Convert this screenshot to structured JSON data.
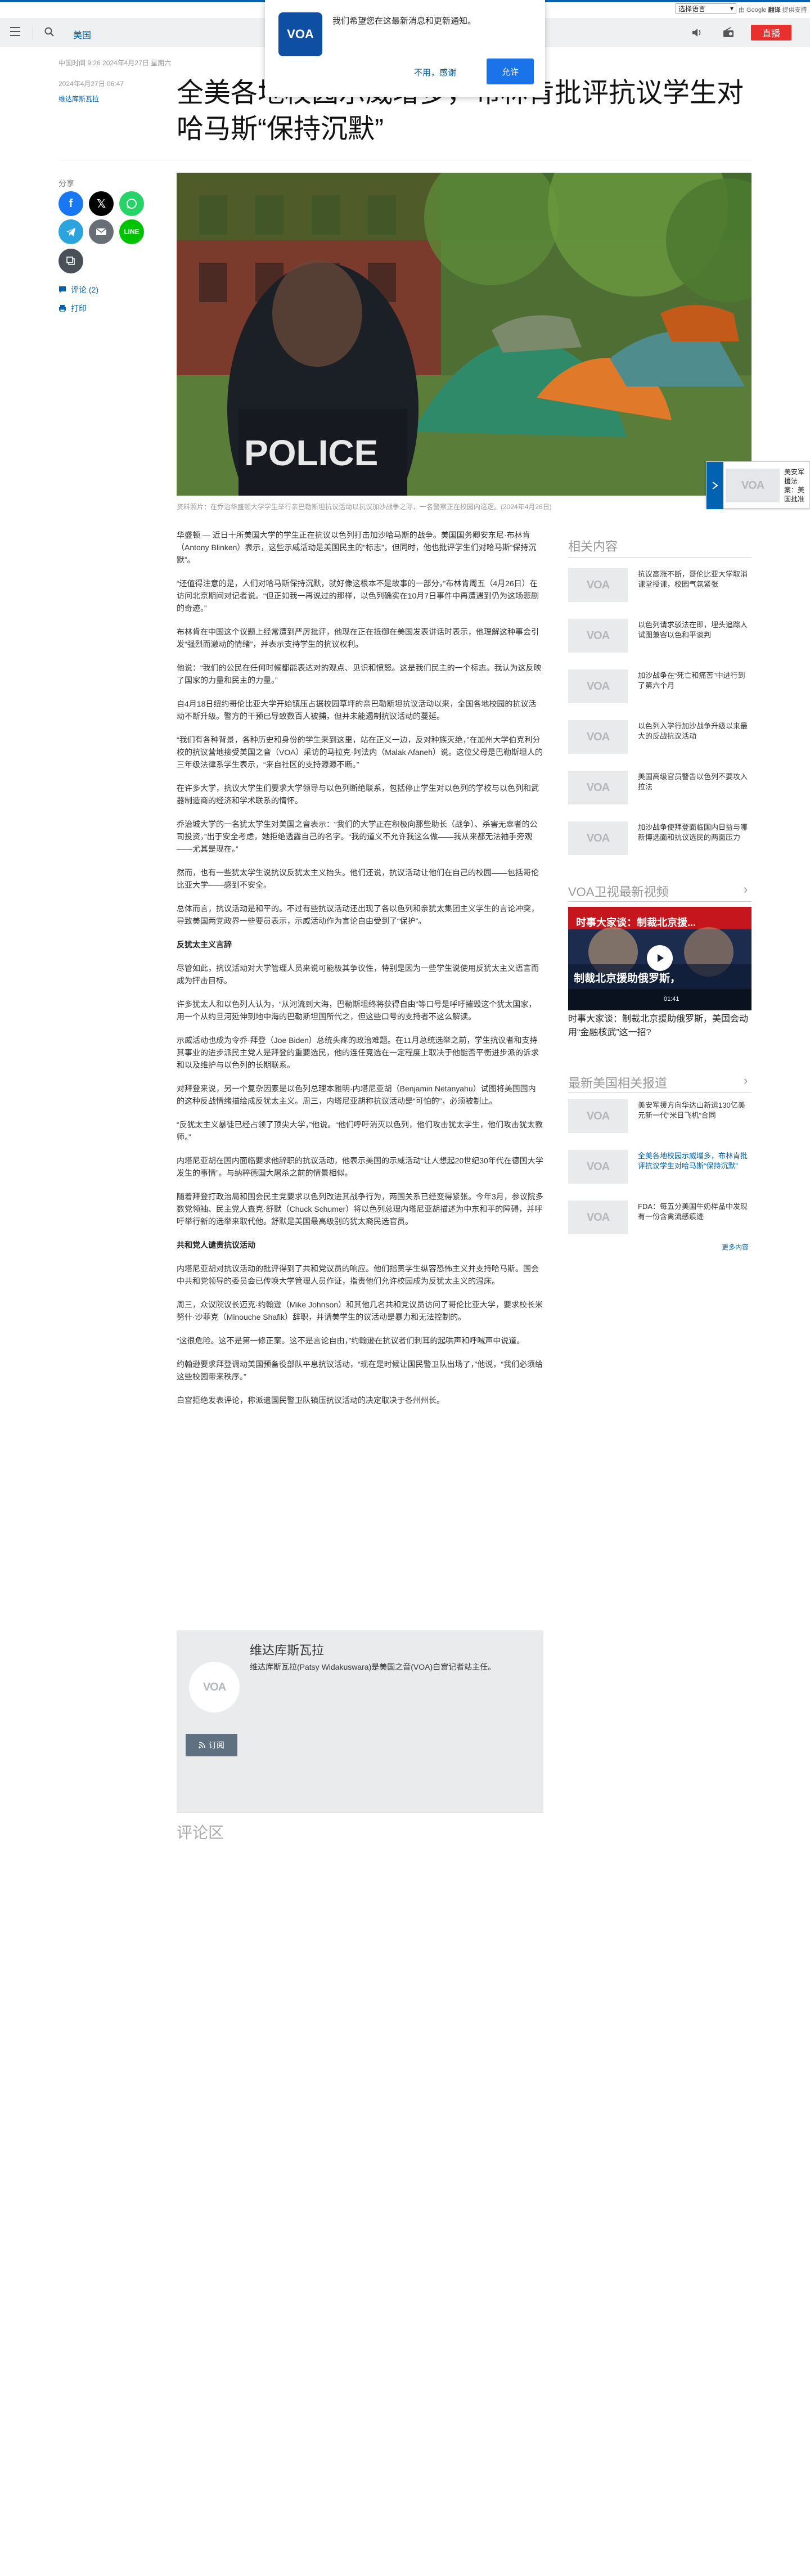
{
  "top": {
    "lang_select": "选择语言",
    "translate_prefix": "由 Google",
    "translate_brand": "翻译",
    "translate_suffix": "提供支持"
  },
  "nav": {
    "section": "美国",
    "live": "直播"
  },
  "popup": {
    "logo": "VOA",
    "message": "我们希望您在这最新消息和更新通知。",
    "decline": "不用，感谢",
    "accept": "允许"
  },
  "article": {
    "meta1": "中国时间 9:26 2024年4月27日 星期六",
    "meta2": "2024年4月27日 06:47",
    "author": "维达库斯瓦拉",
    "headline": "全美各地校园示威增多，布林肯批评抗议学生对哈马斯“保持沉默”",
    "share_label": "分享",
    "comments_link": "评论 (2)",
    "print_link": "打印",
    "caption": "资料照片：在乔治华盛顿大学学生举行亲巴勒斯坦抗议活动以抗议加沙战争之际，一名警察正在校园内巡逻。(2024年4月26日)",
    "police_text": "POLICE",
    "paragraphs": [
      "华盛顿 — 近日十所美国大学的学生正在抗议以色列打击加沙哈马斯的战争。美国国务卿安东尼·布林肯（Antony Blinken）表示，这些示威活动是美国民主的“标志”，但同时，他也批评学生们对哈马斯“保持沉默”。",
      "“还值得注意的是，人们对哈马斯保持沉默，就好像这根本不是故事的一部分，”布林肯周五（4月26日）在访问北京期间对记者说。“但正如我一再说过的那样，以色列确实在10月7日事件中再遭遇到仍为这场悲剧的奇迹。”",
      "布林肯在中国这个议题上经常遭到严厉批评，他现在正在抵御在美国发表讲话时表示，他理解这种事会引发“强烈而激动的情绪”，并表示支持学生的抗议权利。",
      "他说：“我们的公民在任何时候都能表达对的观点、见识和愤怒。这是我们民主的一个标志。我认为这反映了国家的力量和民主的力量。”",
      "自4月18日纽约哥伦比亚大学开始镇压占据校园草坪的亲巴勒斯坦抗议活动以来，全国各地校园的抗议活动不断升级。警方的干预已导致数百人被捕，但并未能遏制抗议活动的蔓延。",
      "“我们有各种背景，各种历史和身份的学生来到这里，站在正义一边，反对种族灭绝，”在加州大学伯克利分校的抗议营地接受美国之音（VOA）采访的马拉克·阿法内（Malak Afaneh）说。这位父母是巴勒斯坦人的三年级法律系学生表示，“来自社区的支持源源不断。”",
      "在许多大学，抗议大学生们要求大学领导与以色列断绝联系，包括停止学生对以色列的学校与以色列和武器制造商的经济和学术联系的情怀。",
      "乔治城大学的一名犹太学生对美国之音表示：“我们的大学正在积极向那些助长（战争）、杀害无辜者的公司投资，”出于安全考虑，她拒绝透露自己的名字。“我的道义不允许我这么做——我从来都无法袖手旁观——尤其是现在。”",
      "然而，也有一些犹太学生说抗议反犹太主义抬头。他们还说，抗议活动让他们在自己的校园——包括哥伦比亚大学——感到不安全。",
      "总体而言，抗议活动是和平的。不过有些抗议活动还出现了各以色列和亲犹太集团主义学生的言论冲突，导致美国两党政界一些要员表示，示威活动作为言论自由受到了“保护”。"
    ],
    "subhead1": "反犹太主义言辞",
    "paragraphs2": [
      "尽管如此，抗议活动对大学管理人员来说可能极其争议性，特别是因为一些学生说使用反犹太主义语言而成为抨击目标。",
      "许多犹太人和以色列人认为，“从河流到大海，巴勒斯坦终将获得自由”等口号是呼吁摧毁这个犹太国家，用一个从约旦河延伸到地中海的巴勒斯坦国所代之，但这些口号的支持者不这么解读。",
      "示威活动也成为令乔·拜登（Joe Biden）总统头疼的政治难题。在11月总统选举之前，学生抗议者和支持其事业的进步派民主党人是拜登的重要选民，他的连任竞选在一定程度上取决于他能否平衡进步派的诉求和以及维护与以色列的长期联系。",
      "对拜登来说，另一个复杂因素是以色列总理本雅明·内塔尼亚胡（Benjamin Netanyahu）试图将美国国内的这种反战情绪描绘成反犹太主义。周三，内塔尼亚胡称抗议活动是“可怕的”，必须被制止。",
      "“反犹太主义暴徒已经占领了顶尖大学，”他说。“他们呼吁消灭以色列，他们攻击犹太学生，他们攻击犹太教师。”",
      "内塔尼亚胡在国内面临要求他辞职的抗议活动，他表示美国的示威活动“让人想起20世纪30年代在德国大学发生的事情”。与纳粹德国大屠杀之前的情景相似。",
      "随着拜登打政治局和国会民主党要求以色列改进其战争行为，两国关系已经变得紧张。今年3月，参议院多数党领袖、民主党人查克·舒默（Chuck Schumer）将以色列总理内塔尼亚胡描述为中东和平的障碍，并呼吁举行新的选举来取代他。舒默是美国最高级别的犹太裔民选官员。"
    ],
    "subhead2": "共和党人谴责抗议活动",
    "paragraphs3": [
      "内塔尼亚胡对抗议活动的批评得到了共和党议员的响应。他们指责学生纵容恐怖主义并支持哈马斯。国会中共和党领导的委员会已传唤大学管理人员作证，指责他们允许校园成为反犹太主义的温床。",
      "周三，众议院议长迈克·约翰逊（Mike Johnson）和其他几名共和党议员访问了哥伦比亚大学，要求校长米努什·沙菲克（Minouche Shafik）辞职，并请美学生的议活动是暴力和无法控制的。",
      "“这很危险。这不是第一修正案。这不是言论自由，”约翰逊在抗议者们刺耳的起哄声和呼喊声中说道。",
      "约翰逊要求拜登调动美国预备役部队平息抗议活动，“现在是时候让国民警卫队出场了，”他说，“我们必须给这些校园带来秩序。”",
      "白宫拒绝发表评论，称派遣国民警卫队镇压抗议活动的决定取决于各州州长。"
    ]
  },
  "author_box": {
    "name": "维达库斯瓦拉",
    "desc": "维达库斯瓦拉(Patsy Widakuswara)是美国之音(VOA)白宫记者站主任。",
    "subscribe": "订阅",
    "avatar": "VOA"
  },
  "comments": {
    "heading": "评论区"
  },
  "flyout": {
    "text": "美安军援法案：美国批准130亿美元的援助合同",
    "logo": "VOA"
  },
  "sidebar": {
    "related_heading": "相关内容",
    "related": [
      "抗议高涨不断，哥伦比亚大学取消课堂授课，校园气氛紧张",
      "以色列请求驳法在即，埋头追踪人试图兼容以色和平谈判",
      "加沙战争在“死亡和痛苦”中进行到了第六个月",
      "以色列入学行加沙战争升级以来最大的反战抗议活动",
      "美国高级官员警告以色列不要攻入拉法",
      "加沙战争使拜登面临国内日益与哪新博选面和抗议选民的两面压力"
    ],
    "video_heading": "VOA卫视最新视频",
    "video_title": "时事大家谈：制裁北京援...",
    "video_band": "制裁北京援助俄罗斯，",
    "video_time": "01:41",
    "video_caption": "时事大家谈：制裁北京援助俄罗斯，美国会动用“金融核武”这一招?",
    "latest_heading": "最新美国相关报道",
    "latest": [
      "美安军援方向华达山新运130亿美元新一代“米日飞机”合同",
      "全美各地校园示威增多，布林肯批评抗议学生对哈马斯“保持沉默”",
      "FDA：每五分美国牛奶样品中发现有一份含禽流感痕迹"
    ],
    "more": "更多内容"
  }
}
